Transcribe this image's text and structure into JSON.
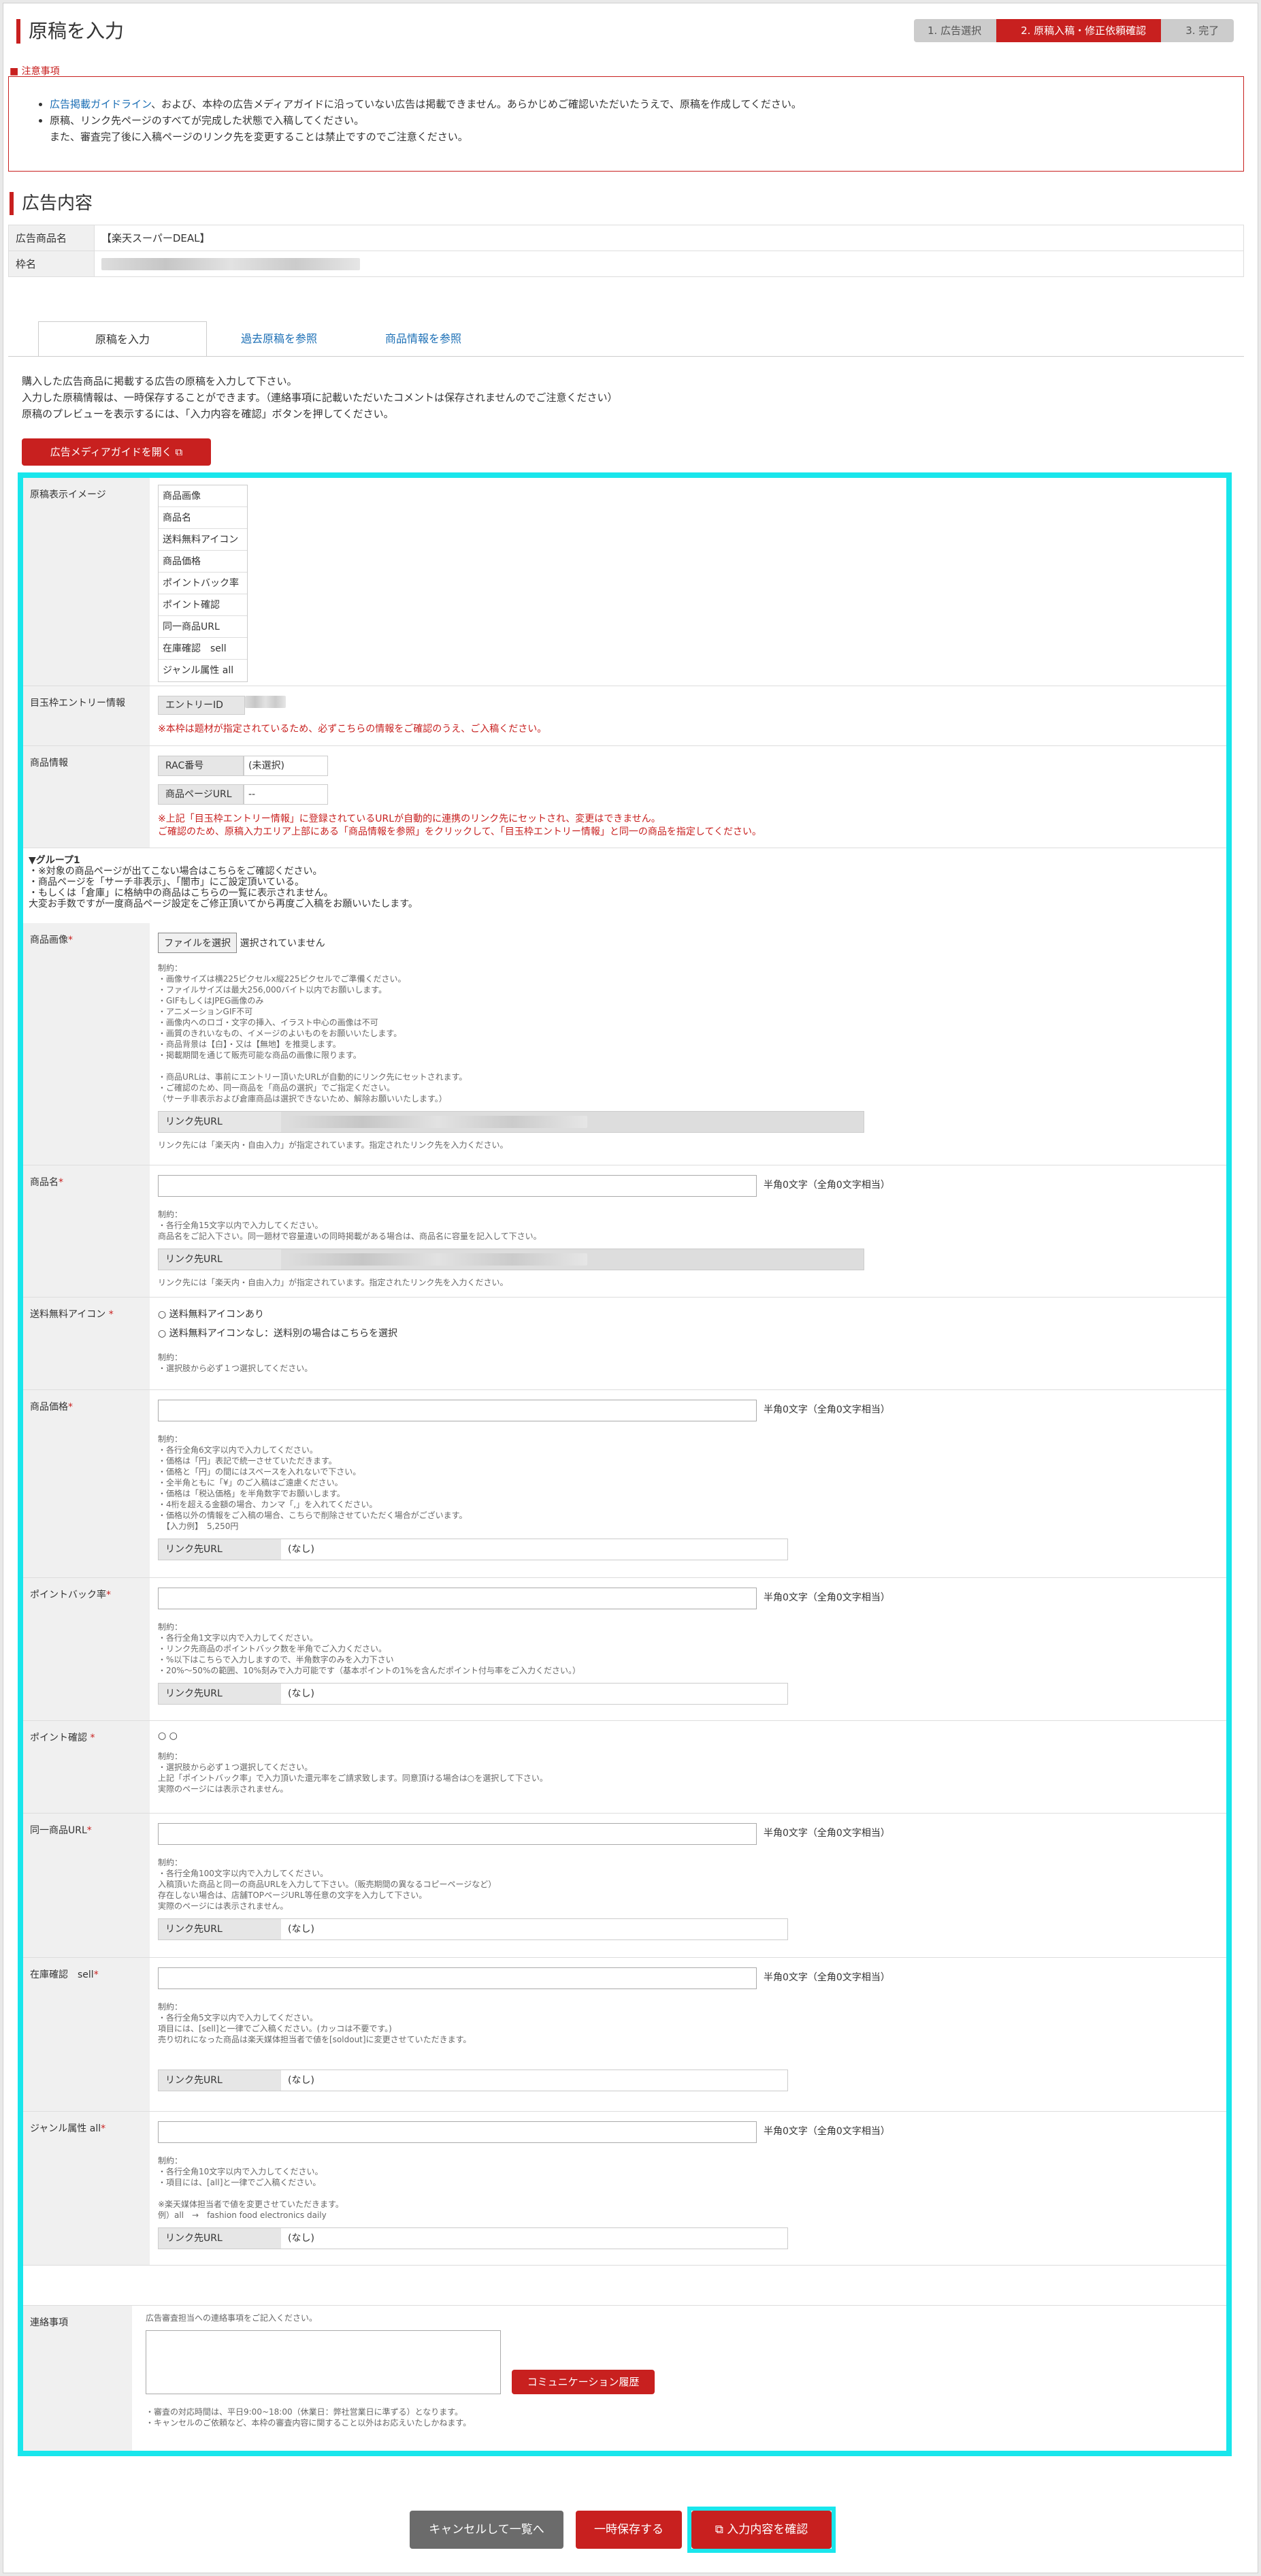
{
  "page_title": "原稿を入力",
  "steps": [
    "1. 広告選択",
    "2. 原稿入稿・修正依頼確認",
    "3. 完了"
  ],
  "notice": {
    "title": "■ 注意事項",
    "link": "広告掲載ガイドライン",
    "line1_rest": "、および、本枠の広告メディアガイドに沿っていない広告は掲載できません。あらかじめご確認いただいたうえで、原稿を作成してください。",
    "line2": "原稿、リンク先ページのすべてが完成した状態で入稿してください。",
    "line3": "また、審査完了後に入稿ページのリンク先を変更することは禁止ですのでご注意ください。"
  },
  "section_title": "広告内容",
  "info": [
    {
      "label": "広告商品名",
      "value": "【楽天スーパーDEAL】"
    },
    {
      "label": "枠名",
      "value": ""
    }
  ],
  "tabs": [
    "原稿を入力",
    "過去原稿を参照",
    "商品情報を参照"
  ],
  "intro": [
    "購入した広告商品に掲載する広告の原稿を入力して下さい。",
    "入力した原稿情報は、一時保存することができます。（連絡事項に記載いただいたコメントは保存されませんのでご注意ください）",
    "原稿のプレビューを表示するには、「入力内容を確認」ボタンを押してください。"
  ],
  "guide_button": "広告メディアガイドを開く",
  "form": {
    "preview": {
      "label": "原稿表示イメージ",
      "items": [
        "商品画像",
        "商品名",
        "送料無料アイコン",
        "商品価格",
        "ポイントバック率",
        "ポイント確認",
        "同一商品URL",
        "在庫確認　sell",
        "ジャンル属性 all"
      ]
    },
    "entry": {
      "label": "目玉枠エントリー情報",
      "field": "エントリーID",
      "note": "※本枠は题材が指定されているため、必ずこちらの情報をご確認のうえ、ご入稿ください。"
    },
    "product": {
      "label": "商品情報",
      "rac": "RAC番号",
      "rac_value": "(未選択)",
      "page": "商品ページURL",
      "page_value": "--",
      "note1": "※上記「目玉枠エントリー情報」に登録されているURLが自動的に連携のリンク先にセットされ、変更はできません。",
      "note2": "ご確認のため、原稿入力エリア上部にある「商品情報を参照」をクリックして、「目玉枠エントリー情報」と同一の商品を指定してください。"
    },
    "group": {
      "title": "▼グループ1",
      "lines": [
        "・※対象の商品ページが出てこない場合はこちらをご確認ください。",
        "・商品ページを「サーチ非表示」、「闇市」にご設定頂いている。",
        "・もしくは「倉庫」に格納中の商品はこちらの一覧に表示されません。",
        "大変お手数ですが一度商品ページ設定をご修正頂いてから再度ご入稿をお願いいたします。"
      ]
    },
    "image": {
      "label": "商品画像",
      "file_button": "ファイルを選択",
      "file_status": "選択されていません",
      "rules": [
        "制約：",
        "・画像サイズは横225ピクセルx縦225ピクセルでご準備ください。",
        "・ファイルサイズは最大256,000バイト以内でお願いします。",
        "・GIFもしくはJPEG画像のみ",
        "・アニメーションGIF不可",
        "・画像内へのロゴ・文字の挿入、イラスト中心の画像は不可",
        "・画質のきれいなもの、イメージのよいものをお願いいたします。",
        "・商品背景は【白】・又は【無地】を推奨します。",
        "・掲載期間を通じて販売可能な商品の画像に限ります。",
        "",
        "・商品URLは、事前にエントリー頂いたURLが自動的にリンク先にセットされます。",
        "・ご確認のため、同一商品を「商品の選択」でご指定ください。",
        "（サーチ非表示および倉庫商品は選択できないため、解除お願いいたします。）"
      ],
      "url_label": "リンク先URL",
      "url_note": "リンク先には「楽天内・自由入力」が指定されています。指定されたリンク先を入力ください。"
    },
    "name": {
      "label": "商品名",
      "count": "半角0文字（全角0文字相当）",
      "rules": [
        "制約：",
        "・各行全角15文字以内で入力してください。",
        "商品名をご記入下さい。同一題材で容量違いの同時掲載がある場合は、商品名に容量を記入して下さい。"
      ],
      "url_label": "リンク先URL",
      "url_note": "リンク先には「楽天内・自由入力」が指定されています。指定されたリンク先を入力ください。"
    },
    "shipping": {
      "label": "送料無料アイコン",
      "opt1": "送料無料アイコンあり",
      "opt2": "送料無料アイコンなし：送料別の場合はこちらを選択",
      "rules": [
        "制約：",
        "・選択肢から必ず１つ選択してください。"
      ]
    },
    "price": {
      "label": "商品価格",
      "count": "半角0文字（全角0文字相当）",
      "rules": [
        "制約：",
        "・各行全角6文字以内で入力してください。",
        "・価格は「円」表記で統一させていただきます。",
        "・価格と「円」の間にはスペースを入れないで下さい。",
        "・全半角ともに「¥」のご入稿はご遠慮ください。",
        "・価格は「税込価格」を半角数字でお願いします。",
        "・4桁を超える金額の場合、カンマ「,」を入れてください。",
        "・価格以外の情報をご入稿の場合、こちらで削除させていただく場合がございます。",
        "　【入力例】　5,250円"
      ],
      "url_label": "リンク先URL",
      "url_value": "(なし)"
    },
    "point": {
      "label": "ポイントバック率",
      "count": "半角0文字（全角0文字相当）",
      "rules": [
        "制約：",
        "・各行全角1文字以内で入力してください。",
        "・リンク先商品のポイントバック数を半角でご入力ください。",
        "・%以下はこちらで入力しますので、半角数字のみを入力下さい",
        "・20%～50%の範囲、10%刻みで入力可能です（基本ポイントの1%を含んだポイント付与率をご入力ください。）"
      ],
      "url_label": "リンク先URL",
      "url_value": "(なし)"
    },
    "point_confirm": {
      "label": "ポイント確認",
      "opt": "○",
      "rules": [
        "制約：",
        "・選択肢から必ず１つ選択してください。",
        "上記「ポイントバック率」で入力頂いた還元率をご請求致します。同意頂ける場合は○を選択して下さい。",
        "実際のページには表示されません。"
      ]
    },
    "same_url": {
      "label": "同一商品URL",
      "count": "半角0文字（全角0文字相当）",
      "rules": [
        "制約：",
        "・各行全角100文字以内で入力してください。",
        "入稿頂いた商品と同一の商品URLを入力して下さい。（販売期間の異なるコピーページなど）",
        "存在しない場合は、店舗TOPページURL等任意の文字を入力して下さい。",
        "実際のページには表示されません。"
      ],
      "url_label": "リンク先URL",
      "url_value": "(なし)"
    },
    "stock": {
      "label": "在庫確認　sell",
      "count": "半角0文字（全角0文字相当）",
      "rules": [
        "制約：",
        "・各行全角5文字以内で入力してください。",
        "項目には、[sell]と一律でご入稿ください。(カッコは不要です。)",
        "売り切れになった商品は楽天媒体担当者で値を[soldout]に変更させていただきます。"
      ],
      "url_label": "リンク先URL",
      "url_value": "(なし)"
    },
    "genre": {
      "label": "ジャンル属性 all",
      "count": "半角0文字（全角0文字相当）",
      "rules": [
        "制約：",
        "・各行全角10文字以内で入力してください。",
        "・項目には、[all]と一律でご入稿ください。",
        "",
        "※楽天媒体担当者で値を変更させていただきます。",
        "例）all　→　fashion food electronics daily"
      ],
      "url_label": "リンク先URL",
      "url_value": "(なし)"
    },
    "contact": {
      "label": "連絡事項",
      "hint": "広告審査担当への連絡事項をご記入ください。",
      "comm_button": "コミュニケーション履歴",
      "notes": [
        "・審査の対応時間は、平日9:00~18:00（休業日：弊社営業日に準ずる）となります。",
        "・キャンセルのご依頼など、本枠の審査内容に関すること以外はお応えいたしかねます。"
      ]
    }
  },
  "buttons": {
    "cancel": "キャンセルして一覧へ",
    "save": "一時保存する",
    "confirm": "入力内容を確認"
  },
  "colors": {
    "accent": "#c8201f",
    "link": "#1a6eb5",
    "highlight": "#19e6ec",
    "cancel": "#6b6b6b"
  }
}
